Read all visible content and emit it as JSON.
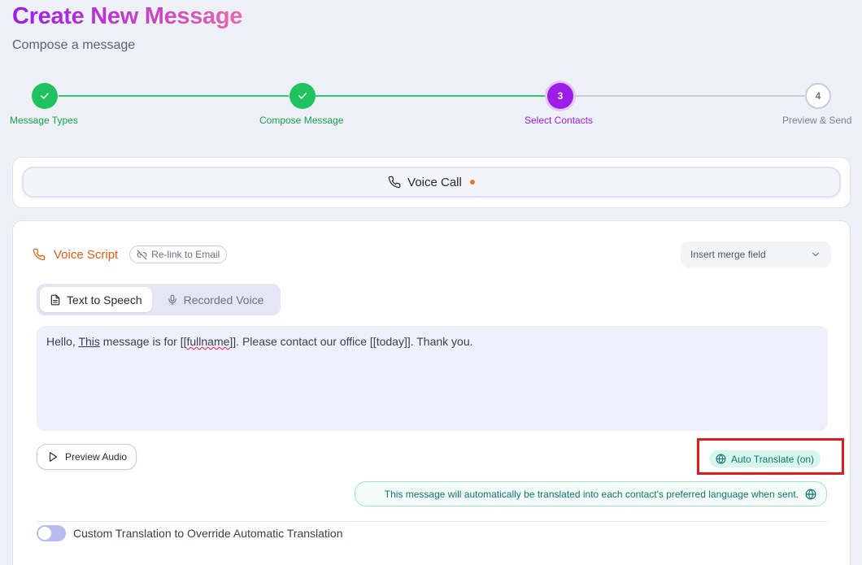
{
  "header": {
    "title": "Create New Message",
    "subtitle": "Compose a message"
  },
  "stepper": {
    "steps": [
      {
        "number": "",
        "label": "Message Types",
        "state": "done"
      },
      {
        "number": "",
        "label": "Compose Message",
        "state": "done"
      },
      {
        "number": "3",
        "label": "Select Contacts",
        "state": "active"
      },
      {
        "number": "4",
        "label": "Preview & Send",
        "state": "todo"
      }
    ]
  },
  "channel": {
    "label": "Voice Call"
  },
  "script": {
    "title": "Voice Script",
    "relink_label": "Re-link to Email",
    "merge_field_placeholder": "Insert merge field",
    "modes": [
      {
        "label": "Text to Speech",
        "active": true
      },
      {
        "label": "Recorded Voice",
        "active": false
      }
    ],
    "text": {
      "part1": "Hello, ",
      "part2": "This",
      "part3": " message is for [[",
      "part4": "fullname",
      "part5": "]]. Please contact our office [[today]]. Thank you."
    },
    "preview_audio_label": "Preview Audio",
    "auto_translate_label": "Auto Translate (on)",
    "translate_note": "This message will automatically be translated into each contact's preferred language when sent.",
    "custom_translation_label": "Custom Translation to Override Automatic Translation"
  },
  "colors": {
    "accent_purple": "#9b1de6",
    "success_green": "#1fc25f",
    "voice_orange": "#e8590c",
    "translate_teal": "#0f766e",
    "highlight_red": "#e01b1b"
  }
}
